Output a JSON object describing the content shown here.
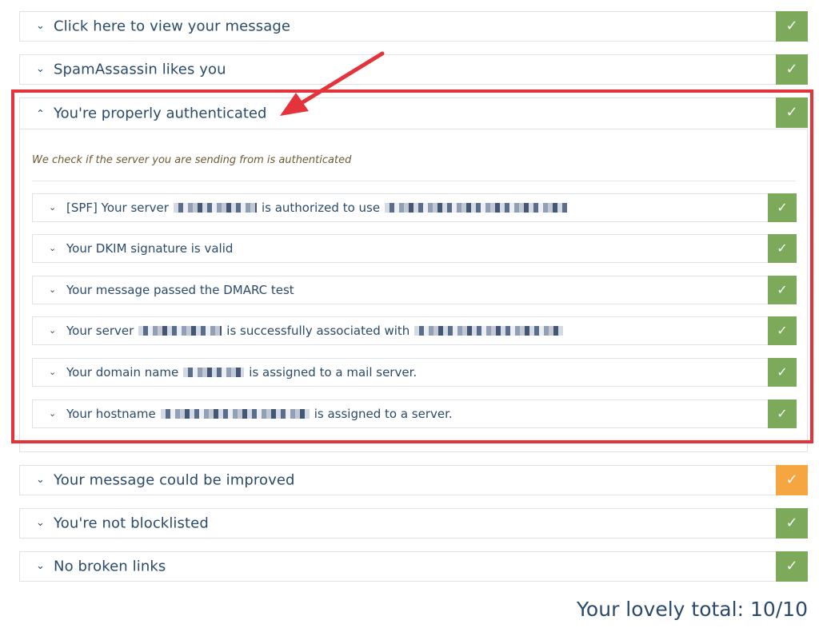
{
  "panels_top": [
    {
      "label": "Click here to view your message",
      "status_icon": "check-icon",
      "status": "pass",
      "color": "#7daa5a",
      "check": "✓"
    },
    {
      "label": "SpamAssassin likes you",
      "status_icon": "check-icon",
      "status": "pass",
      "color": "#7daa5a",
      "check": "✓"
    }
  ],
  "auth": {
    "label": "You're properly authenticated",
    "check": "✓",
    "description": "We check if the server you are sending from is authenticated",
    "items": [
      {
        "prefix": "[SPF] Your server",
        "middle": "is authorized to use",
        "suffix": "",
        "check": "✓"
      },
      {
        "prefix": "Your DKIM signature is valid",
        "middle": "",
        "suffix": "",
        "check": "✓"
      },
      {
        "prefix": "Your message passed the DMARC test",
        "middle": "",
        "suffix": "",
        "check": "✓"
      },
      {
        "prefix": "Your server",
        "middle": "is successfully associated with",
        "suffix": "",
        "check": "✓"
      },
      {
        "prefix": "Your domain name",
        "middle": "is assigned to a mail server.",
        "suffix": "",
        "check": "✓"
      },
      {
        "prefix": "Your hostname",
        "middle": "is assigned to a server.",
        "suffix": "",
        "check": "✓"
      }
    ]
  },
  "panels_bottom": [
    {
      "label": "Your message could be improved",
      "status": "warn",
      "color": "#f5a641",
      "check": "✓"
    },
    {
      "label": "You're not blocklisted",
      "status": "pass",
      "color": "#7daa5a",
      "check": "✓"
    },
    {
      "label": "No broken links",
      "status": "pass",
      "color": "#7daa5a",
      "check": "✓"
    }
  ],
  "chevrons": {
    "down": "⌄",
    "up": "⌃"
  },
  "total": "Your lovely total: 10/10",
  "highlight_color": "#e5333b"
}
